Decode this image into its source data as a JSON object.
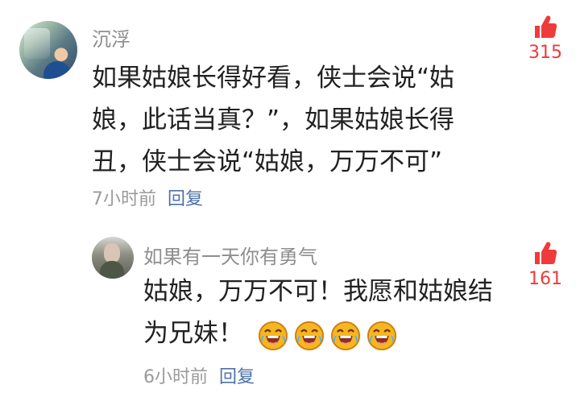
{
  "comments": [
    {
      "username": "沉浮",
      "text_lines": [
        "如果姑娘长得好看，侠士会说“姑",
        "娘，此话当真？”，如果姑娘长得",
        "丑，侠士会说“姑娘，万万不可”"
      ],
      "timestamp": "7小时前",
      "reply_label": "回复",
      "likes": "315"
    },
    {
      "username": "如果有一天你有勇气",
      "text_lines": [
        "姑娘，万万不可！我愿和姑娘结",
        "为兄妹！"
      ],
      "emoji_icons": [
        "laughing-emoji-icon",
        "laughing-emoji-icon",
        "laughing-emoji-icon",
        "laughing-emoji-icon"
      ],
      "timestamp": "6小时前",
      "reply_label": "回复",
      "likes": "161"
    }
  ],
  "colors": {
    "username": "#8e8e8e",
    "text": "#222222",
    "timestamp": "#9a9a9a",
    "reply_link": "#4d72a7",
    "like_accent": "#ef3b3b",
    "emoji_face": "#f6b620"
  },
  "icons": {
    "avatar_main": "avatar",
    "avatar_reply": "avatar",
    "like": "thumbs-up-icon"
  }
}
